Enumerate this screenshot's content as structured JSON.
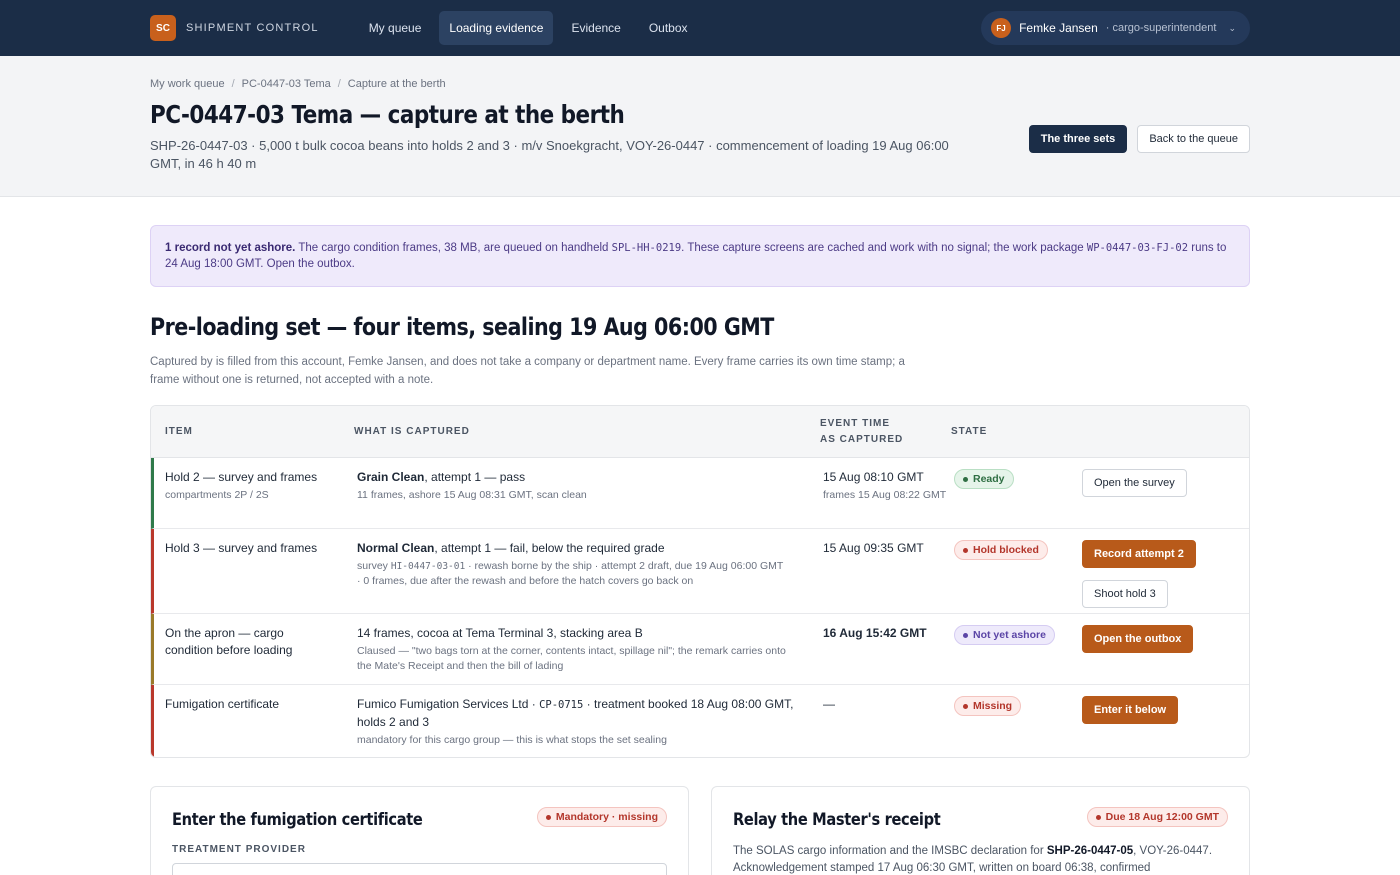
{
  "nav": {
    "brand_logo": "SC",
    "brand_name": "SHIPMENT CONTROL",
    "items": [
      {
        "label": "My queue"
      },
      {
        "label": "Loading evidence"
      },
      {
        "label": "Evidence"
      },
      {
        "label": "Outbox"
      }
    ],
    "user": {
      "initials": "FJ",
      "name": "Femke Jansen",
      "role": "· cargo-superintendent"
    }
  },
  "header": {
    "breadcrumb": [
      "My work queue",
      "PC-0447-03 Tema",
      "Capture at the berth"
    ],
    "title": "PC-0447-03 Tema — capture at the berth",
    "subtitle": "SHP-26-0447-03 · 5,000 t bulk cocoa beans into holds 2 and 3 · m/v Snoekgracht, VOY-26-0447 · commencement of loading 19 Aug 06:00 GMT, in 46 h 40 m",
    "btn_sets": "The three sets",
    "btn_back": "Back to the queue"
  },
  "banner": {
    "bold": "1 record not yet ashore.",
    "text1": " The cargo condition frames, 38 MB, are queued on handheld ",
    "code1": "SPL-HH-0219",
    "text2": ". These capture screens are cached and work with no signal; the work package ",
    "code2": "WP-0447-03-FJ-02",
    "text3": " runs to 24 Aug 18:00 GMT. Open the outbox."
  },
  "section": {
    "title": "Pre-loading set — four items, sealing 19 Aug 06:00 GMT",
    "desc": "Captured by is filled from this account, Femke Jansen, and does not take a company or department name. Every frame carries its own time stamp; a frame without one is returned, not accepted with a note."
  },
  "table": {
    "headers": {
      "item": "ITEM",
      "what": "WHAT IS CAPTURED",
      "time1": "EVENT TIME",
      "time2": "AS CAPTURED",
      "state": "STATE"
    },
    "rows": [
      {
        "item": "Hold 2 — survey and frames",
        "item_sub": "compartments 2P / 2S",
        "what_bold": "Grain Clean",
        "what_rest": ", attempt 1 — pass",
        "what_sub": "11 frames, ashore 15 Aug 08:31 GMT, scan clean",
        "time": "15 Aug 08:10 GMT",
        "time_sub": "frames 15 Aug 08:22 GMT",
        "state": "Ready",
        "actions": [
          "Open the survey"
        ]
      },
      {
        "item": "Hold 3 — survey and frames",
        "what_bold": "Normal Clean",
        "what_rest": ", attempt 1 — fail, below the required grade",
        "what_sub_a": "survey ",
        "what_sub_code": "HI-0447-03-01",
        "what_sub_b": " · rewash borne by the ship · attempt 2 draft, due 19 Aug 06:00 GMT · 0 frames, due after the rewash and before the hatch covers go back on",
        "time": "15 Aug 09:35 GMT",
        "state": "Hold blocked",
        "actions": [
          "Record attempt 2",
          "Shoot hold 3"
        ]
      },
      {
        "item": "On the apron — cargo condition before loading",
        "what_main": "14 frames, cocoa at Tema Terminal 3, stacking area B",
        "what_sub": "Claused — \"two bags torn at the corner, contents intact, spillage nil\"; the remark carries onto the Mate's Receipt and then the bill of lading",
        "time": "16 Aug 15:42 GMT",
        "state": "Not yet ashore",
        "actions": [
          "Open the outbox"
        ]
      },
      {
        "item": "Fumigation certificate",
        "what_a": "Fumico Fumigation Services Ltd · ",
        "what_code": "CP-0715",
        "what_b": " · treatment booked 18 Aug 08:00 GMT, holds 2 and 3",
        "what_sub": "mandatory for this cargo group — this is what stops the set sealing",
        "time": "—",
        "state": "Missing",
        "actions": [
          "Enter it below"
        ]
      }
    ]
  },
  "cards": {
    "fumigation": {
      "title": "Enter the fumigation certificate",
      "badge": "Mandatory · missing",
      "field_label": "TREATMENT PROVIDER"
    },
    "receipt": {
      "title": "Relay the Master's receipt",
      "badge": "Due 18 Aug 12:00 GMT",
      "text_a": "The SOLAS cargo information and the IMSBC declaration for ",
      "text_bold": "SHP-26-0447-05",
      "text_b": ", VOY-26-0447. Acknowledgement stamped 17 Aug 06:30 GMT, written on board 06:38, confirmed"
    }
  }
}
